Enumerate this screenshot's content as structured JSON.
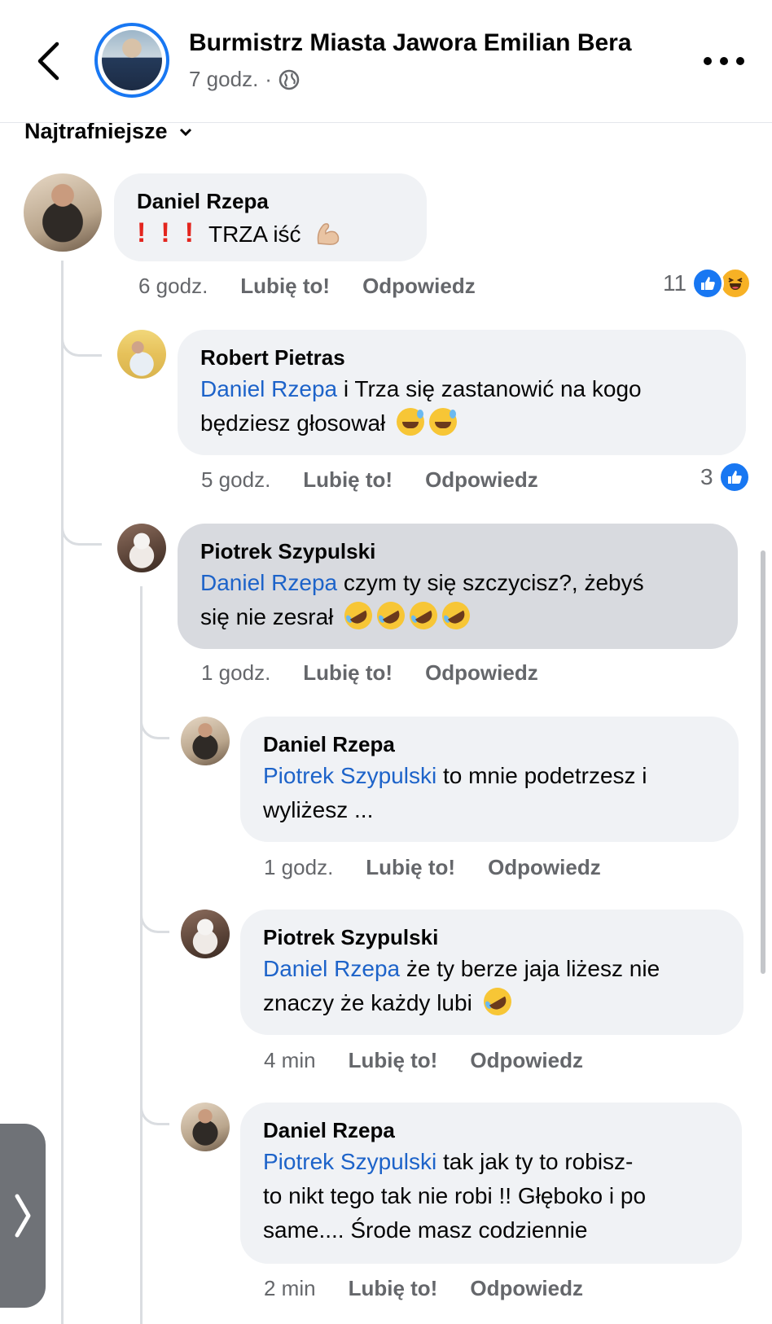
{
  "header": {
    "title": "Burmistrz Miasta Jawora Emilian Bera",
    "time": "7 godz.",
    "separator": "·"
  },
  "sort": {
    "label": "Najtrafniejsze"
  },
  "comments": [
    {
      "author": "Daniel Rzepa",
      "text": "TRZA iść",
      "time": "6 godz.",
      "like": "Lubię to!",
      "reply": "Odpowiedz",
      "reaction_count": "11",
      "reactions": [
        "like-icon",
        "haha-icon"
      ]
    },
    {
      "author": "Robert Pietras",
      "mention": "Daniel Rzepa",
      "text_line1": " i Trza się  zastanowić na  kogo",
      "text_line2": "będziesz głosował",
      "time": "5 godz.",
      "like": "Lubię to!",
      "reply": "Odpowiedz",
      "reaction_count": "3"
    },
    {
      "author": "Piotrek Szypulski",
      "mention": "Daniel Rzepa",
      "text_line1": " czym ty się szczycisz?, żebyś",
      "text_line2": "się nie zesrał",
      "time": "1 godz.",
      "like": "Lubię to!",
      "reply": "Odpowiedz"
    },
    {
      "author": "Daniel Rzepa",
      "mention": "Piotrek Szypulski",
      "text_line1": " to mnie podetrzesz i",
      "text_line2": "wyliżesz ...",
      "time": "1 godz.",
      "like": "Lubię to!",
      "reply": "Odpowiedz"
    },
    {
      "author": "Piotrek Szypulski",
      "mention": "Daniel Rzepa",
      "text_line1": " że ty berze jaja liżesz nie",
      "text_line2": "znaczy że każdy lubi",
      "time": "4 min",
      "like": "Lubię to!",
      "reply": "Odpowiedz"
    },
    {
      "author": "Daniel Rzepa",
      "mention": "Piotrek Szypulski",
      "text_line1": " tak jak ty to robisz-",
      "text_line2": "to nikt tego tak nie robi !! Głęboko i po",
      "text_line3": "same.... Środe masz codziennie",
      "time": "2 min",
      "like": "Lubię to!",
      "reply": "Odpowiedz"
    }
  ],
  "colors": {
    "accent": "#1877f2",
    "mention": "#1d63c9",
    "bubble": "#f0f2f5",
    "bubble_active": "#d8dadf",
    "secondary_text": "#65676b"
  }
}
